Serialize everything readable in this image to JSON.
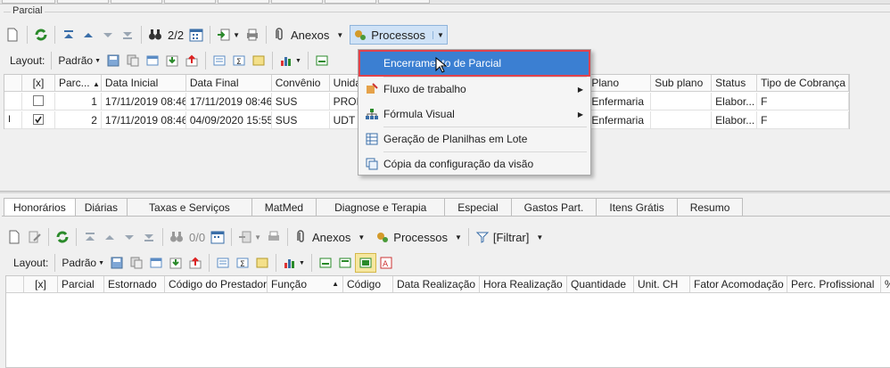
{
  "section": {
    "label": "Parcial"
  },
  "toolbar1": {
    "pager": "2/2",
    "anexos": "Anexos",
    "processos": "Processos"
  },
  "toolbar2": {
    "layout_label": "Layout:",
    "layout_value": "Padrão"
  },
  "grid1": {
    "columns": [
      "[x]",
      "Parc...",
      "Data Inicial",
      "Data Final",
      "Convênio",
      "Unida",
      "Plano",
      "Sub plano",
      "Status",
      "Tipo de Cobrança"
    ],
    "rows": [
      {
        "num": "1",
        "data_inicial": "17/11/2019 08:46",
        "data_final": "17/11/2019 08:46",
        "convenio": "SUS",
        "unidade": "PRON",
        "plano": "Enfermaria",
        "sub_plano": "",
        "status": "Elabor...",
        "tipo": "F",
        "checked": false
      },
      {
        "num": "2",
        "data_inicial": "17/11/2019 08:46",
        "data_final": "04/09/2020 15:55",
        "convenio": "SUS",
        "unidade": "UDT -",
        "plano": "Enfermaria",
        "sub_plano": "",
        "status": "Elabor...",
        "tipo": "F",
        "checked": true
      }
    ],
    "row_cursor": "I"
  },
  "menu": {
    "items": [
      {
        "label": "Encerramento de Parcial",
        "highlighted": true
      },
      {
        "label": "Fluxo de trabalho",
        "submenu": true
      },
      {
        "label": "Fórmula Visual",
        "submenu": true
      },
      {
        "label": "Geração de Planilhas em Lote"
      },
      {
        "label": "Cópia da configuração da visão"
      }
    ]
  },
  "tabs": [
    "Honorários",
    "Diárias",
    "Taxas e Serviços",
    "MatMed",
    "Diagnose e Terapia",
    "Especial",
    "Gastos Part.",
    "Itens Grátis",
    "Resumo"
  ],
  "toolbar3": {
    "pager": "0/0",
    "anexos": "Anexos",
    "processos": "Processos",
    "filtrar": "[Filtrar]"
  },
  "toolbar4": {
    "layout_label": "Layout:",
    "layout_value": "Padrão"
  },
  "grid2": {
    "columns": [
      "[x]",
      "Parcial",
      "Estornado",
      "Código do Prestador",
      "Função",
      "Código",
      "Data Realização",
      "Hora Realização",
      "Quantidade",
      "Unit. CH",
      "Fator Acomodação",
      "Perc. Profissional",
      "%"
    ]
  },
  "colors": {
    "accent": "#3b7fd2",
    "highlight_border": "#e0424c",
    "button_hover": "#cfe2f6"
  }
}
